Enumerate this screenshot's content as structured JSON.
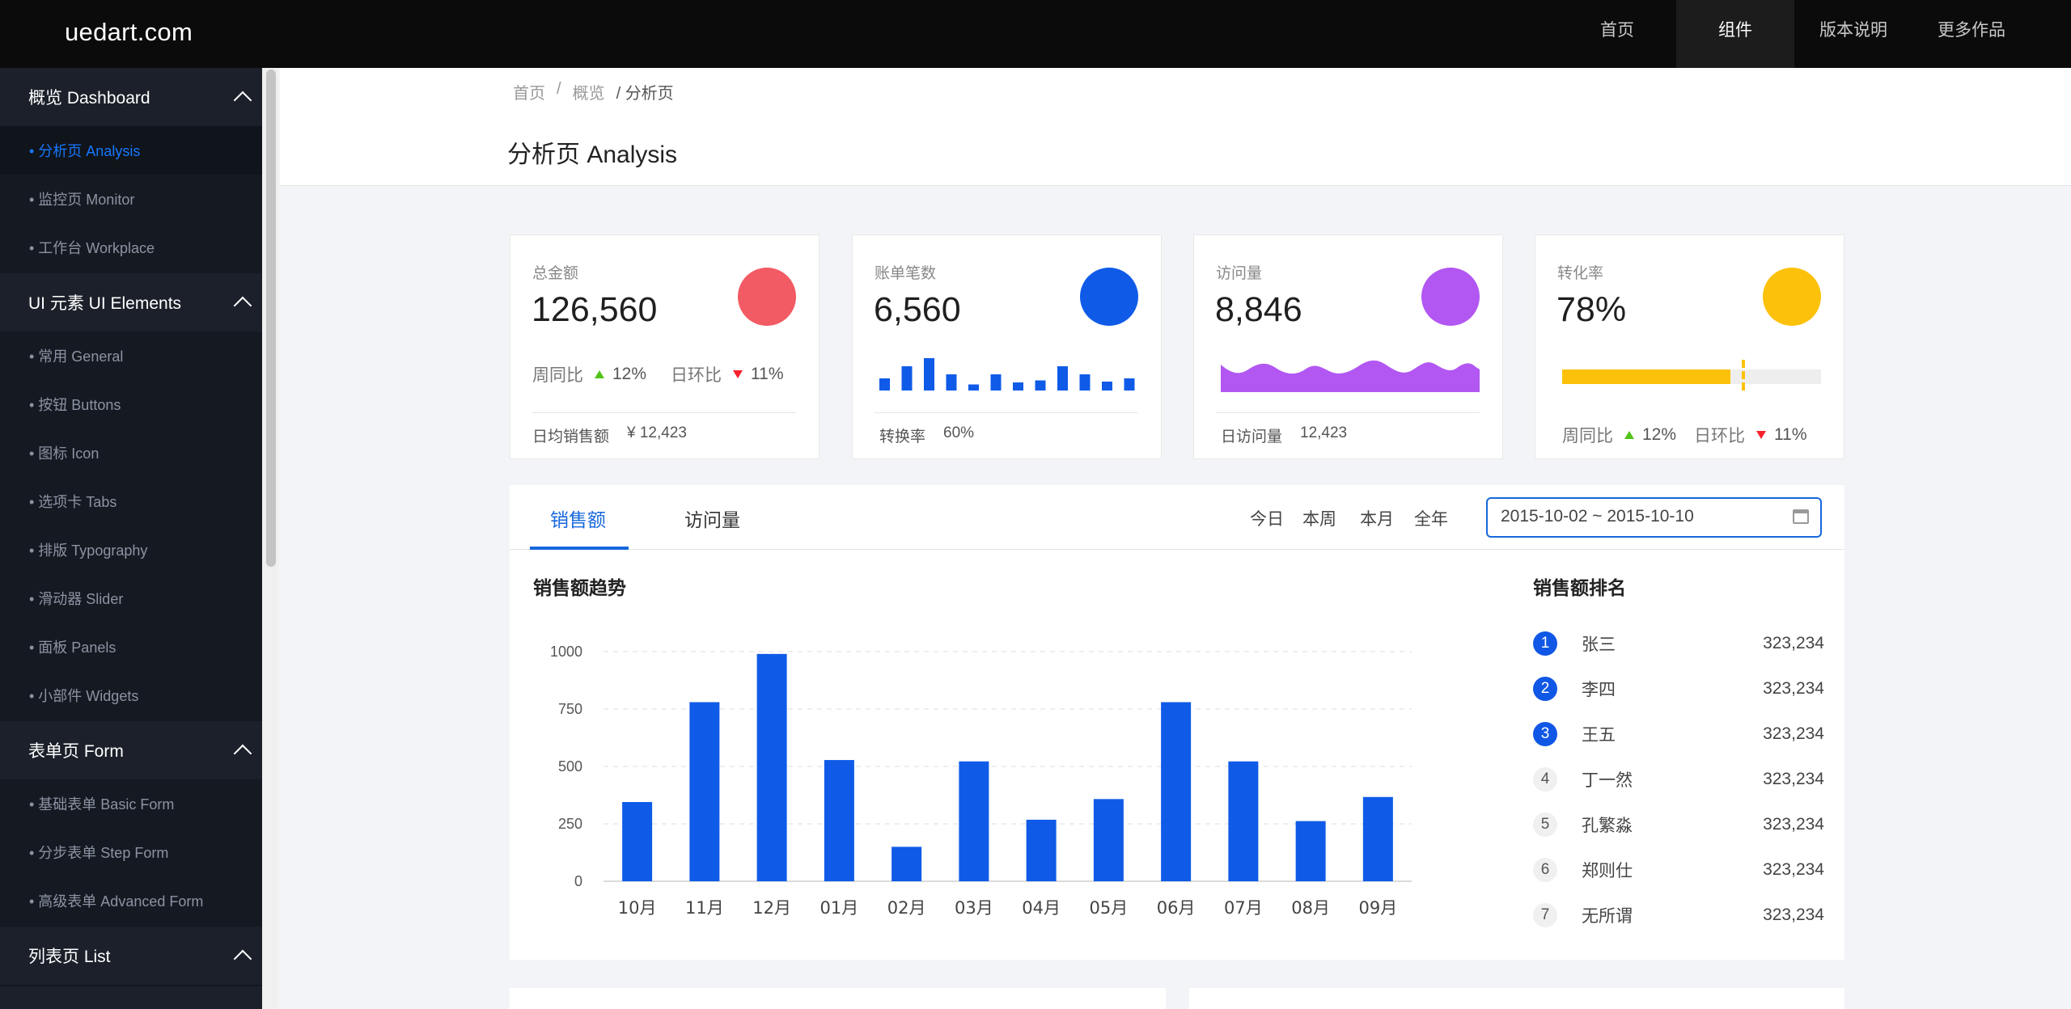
{
  "app": {
    "logo": "uedart.com"
  },
  "topnav": [
    {
      "label": "首页",
      "active": false
    },
    {
      "label": "组件",
      "active": true
    },
    {
      "label": "版本说明",
      "active": false
    },
    {
      "label": "更多作品",
      "active": false
    }
  ],
  "sidebar": {
    "groups": [
      {
        "title": "概览 Dashboard",
        "items": [
          "• 分析页 Analysis",
          "• 监控页 Monitor",
          "• 工作台 Workplace"
        ],
        "active_index": 0
      },
      {
        "title": "UI 元素 UI Elements",
        "items": [
          "• 常用 General",
          "• 按钮 Buttons",
          "• 图标 Icon",
          "• 选项卡 Tabs",
          "• 排版 Typography",
          "• 滑动器 Slider",
          "• 面板 Panels",
          "• 小部件 Widgets"
        ],
        "active_index": -1
      },
      {
        "title": "表单页 Form",
        "items": [
          "• 基础表单 Basic Form",
          "• 分步表单 Step Form",
          "• 高级表单 Advanced Form"
        ],
        "active_index": -1
      },
      {
        "title": "列表页 List",
        "items": [],
        "active_index": -1
      }
    ]
  },
  "breadcrumb": {
    "home": "首页",
    "sep1": "/",
    "overview": "概览",
    "sep2": "/",
    "current": "分析页"
  },
  "page_title": "分析页 Analysis",
  "cards": {
    "total": {
      "label": "总金额",
      "value": "126,560",
      "color": "#f25b64",
      "wow_label": "周同比",
      "wow": "12%",
      "dod_label": "日环比",
      "dod": "11%",
      "foot_label": "日均销售额",
      "foot_value": "¥ 12,423"
    },
    "orders": {
      "label": "账单笔数",
      "value": "6,560",
      "color": "#0f5be8",
      "foot_label": "转换率",
      "foot_value": "60%",
      "mini_bars": [
        3,
        6,
        8,
        4,
        1.5,
        4,
        2,
        2.5,
        6,
        4,
        2.2,
        3
      ]
    },
    "visits": {
      "label": "访问量",
      "value": "8,846",
      "color": "#b257f2",
      "foot_label": "日访问量",
      "foot_value": "12,423"
    },
    "conversion": {
      "label": "转化率",
      "value": "78%",
      "color": "#fcc10a",
      "progress": 0.65,
      "target": 0.7,
      "wow_label": "周同比",
      "wow": "12%",
      "dod_label": "日环比",
      "dod": "11%"
    }
  },
  "sales_panel": {
    "tabs": [
      "销售额",
      "访问量"
    ],
    "ranges": [
      "今日",
      "本周",
      "本月",
      "全年"
    ],
    "date_range": "2015-10-02 ~ 2015-10-10",
    "trend_title": "销售额趋势",
    "rank_title": "销售额排名",
    "ranking": [
      {
        "no": "1",
        "name": "张三",
        "value": "323,234"
      },
      {
        "no": "2",
        "name": "李四",
        "value": "323,234"
      },
      {
        "no": "3",
        "name": "王五",
        "value": "323,234"
      },
      {
        "no": "4",
        "name": "丁一然",
        "value": "323,234"
      },
      {
        "no": "5",
        "name": "孔繁淼",
        "value": "323,234"
      },
      {
        "no": "6",
        "name": "郑则仕",
        "value": "323,234"
      },
      {
        "no": "7",
        "name": "无所谓",
        "value": "323,234"
      }
    ]
  },
  "chart_data": {
    "type": "bar",
    "categories": [
      "10月",
      "11月",
      "12月",
      "01月",
      "02月",
      "03月",
      "04月",
      "05月",
      "06月",
      "07月",
      "08月",
      "09月"
    ],
    "values": [
      345,
      780,
      990,
      528,
      150,
      522,
      268,
      358,
      780,
      522,
      262,
      367
    ],
    "yticks": [
      0,
      250,
      500,
      750,
      1000
    ],
    "ylim": [
      0,
      1000
    ],
    "color": "#0f5be8",
    "grid": true
  }
}
